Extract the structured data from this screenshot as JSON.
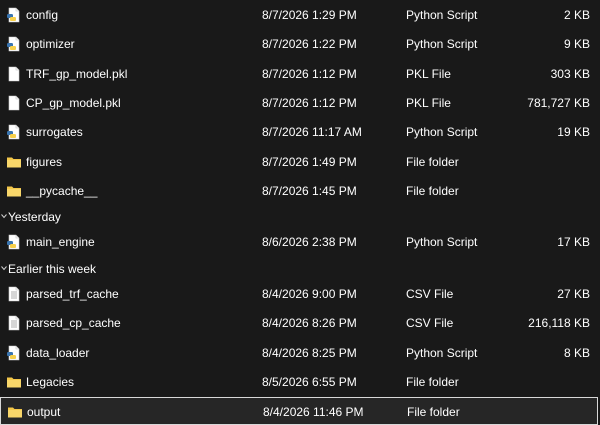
{
  "files_a": [
    {
      "icon": "python-file-icon",
      "name": "config",
      "modified": "8/7/2026 1:29 PM",
      "type": "Python Script",
      "size": "2 KB"
    },
    {
      "icon": "python-file-icon",
      "name": "optimizer",
      "modified": "8/7/2026 1:22 PM",
      "type": "Python Script",
      "size": "9 KB"
    },
    {
      "icon": "blank-file-icon",
      "name": "TRF_gp_model.pkl",
      "modified": "8/7/2026 1:12 PM",
      "type": "PKL File",
      "size": "303 KB"
    },
    {
      "icon": "blank-file-icon",
      "name": "CP_gp_model.pkl",
      "modified": "8/7/2026 1:12 PM",
      "type": "PKL File",
      "size": "781,727 KB"
    },
    {
      "icon": "python-file-icon",
      "name": "surrogates",
      "modified": "8/7/2026 11:17 AM",
      "type": "Python Script",
      "size": "19 KB"
    },
    {
      "icon": "folder-icon",
      "name": "figures",
      "modified": "8/7/2026 1:49 PM",
      "type": "File folder",
      "size": ""
    },
    {
      "icon": "folder-icon",
      "name": "__pycache__",
      "modified": "8/7/2026 1:45 PM",
      "type": "File folder",
      "size": ""
    }
  ],
  "group_yesterday": "Yesterday",
  "files_b": [
    {
      "icon": "python-file-icon",
      "name": "main_engine",
      "modified": "8/6/2026 2:38 PM",
      "type": "Python Script",
      "size": "17 KB"
    }
  ],
  "group_earlier": "Earlier this week",
  "files_c": [
    {
      "icon": "csv-file-icon",
      "name": "parsed_trf_cache",
      "modified": "8/4/2026 9:00 PM",
      "type": "CSV File",
      "size": "27 KB"
    },
    {
      "icon": "csv-file-icon",
      "name": "parsed_cp_cache",
      "modified": "8/4/2026 8:26 PM",
      "type": "CSV File",
      "size": "216,118 KB"
    },
    {
      "icon": "python-file-icon",
      "name": "data_loader",
      "modified": "8/4/2026 8:25 PM",
      "type": "Python Script",
      "size": "8 KB"
    },
    {
      "icon": "folder-icon",
      "name": "Legacies",
      "modified": "8/5/2026 6:55 PM",
      "type": "File folder",
      "size": ""
    },
    {
      "icon": "folder-icon",
      "name": "output",
      "modified": "8/4/2026 11:46 PM",
      "type": "File folder",
      "size": "",
      "selected": true
    }
  ],
  "colors": {
    "background": "#191919",
    "folder": "#f3c74a",
    "python_blue": "#3a75b0",
    "python_yellow": "#f7d04b",
    "selection_border": "#d8d8d8"
  }
}
